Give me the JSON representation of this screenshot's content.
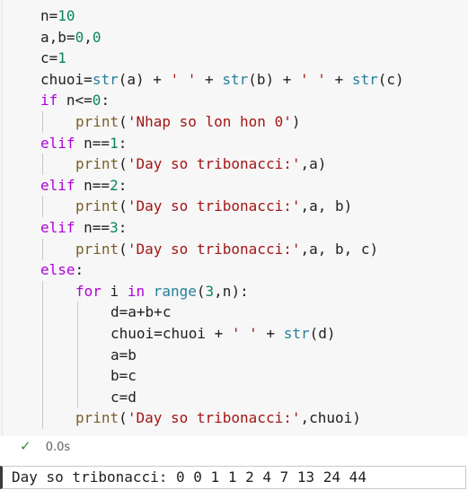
{
  "code": {
    "lines": [
      {
        "indent": 0,
        "tokens": [
          {
            "t": "n",
            "c": "plain"
          },
          {
            "t": "=",
            "c": "op"
          },
          {
            "t": "10",
            "c": "nm"
          }
        ]
      },
      {
        "indent": 0,
        "tokens": [
          {
            "t": "a",
            "c": "plain"
          },
          {
            "t": ",",
            "c": "op"
          },
          {
            "t": "b",
            "c": "plain"
          },
          {
            "t": "=",
            "c": "op"
          },
          {
            "t": "0",
            "c": "nm"
          },
          {
            "t": ",",
            "c": "op"
          },
          {
            "t": "0",
            "c": "nm"
          }
        ]
      },
      {
        "indent": 0,
        "tokens": [
          {
            "t": "c",
            "c": "plain"
          },
          {
            "t": "=",
            "c": "op"
          },
          {
            "t": "1",
            "c": "nm"
          }
        ]
      },
      {
        "indent": 0,
        "tokens": [
          {
            "t": "chuoi",
            "c": "plain"
          },
          {
            "t": "=",
            "c": "op"
          },
          {
            "t": "str",
            "c": "fn"
          },
          {
            "t": "(a) + ",
            "c": "plain"
          },
          {
            "t": "' '",
            "c": "st"
          },
          {
            "t": " + ",
            "c": "plain"
          },
          {
            "t": "str",
            "c": "fn"
          },
          {
            "t": "(b) + ",
            "c": "plain"
          },
          {
            "t": "' '",
            "c": "st"
          },
          {
            "t": " + ",
            "c": "plain"
          },
          {
            "t": "str",
            "c": "fn"
          },
          {
            "t": "(c)",
            "c": "plain"
          }
        ]
      },
      {
        "indent": 0,
        "tokens": [
          {
            "t": "if",
            "c": "kw"
          },
          {
            "t": " n<=",
            "c": "plain"
          },
          {
            "t": "0",
            "c": "nm"
          },
          {
            "t": ":",
            "c": "plain"
          }
        ]
      },
      {
        "indent": 1,
        "tokens": [
          {
            "t": "print",
            "c": "bi"
          },
          {
            "t": "(",
            "c": "plain"
          },
          {
            "t": "'Nhap so lon hon 0'",
            "c": "st"
          },
          {
            "t": ")",
            "c": "plain"
          }
        ]
      },
      {
        "indent": 0,
        "tokens": [
          {
            "t": "elif",
            "c": "kw"
          },
          {
            "t": " n==",
            "c": "plain"
          },
          {
            "t": "1",
            "c": "nm"
          },
          {
            "t": ":",
            "c": "plain"
          }
        ]
      },
      {
        "indent": 1,
        "tokens": [
          {
            "t": "print",
            "c": "bi"
          },
          {
            "t": "(",
            "c": "plain"
          },
          {
            "t": "'Day so tribonacci:'",
            "c": "st"
          },
          {
            "t": ",a)",
            "c": "plain"
          }
        ]
      },
      {
        "indent": 0,
        "tokens": [
          {
            "t": "elif",
            "c": "kw"
          },
          {
            "t": " n==",
            "c": "plain"
          },
          {
            "t": "2",
            "c": "nm"
          },
          {
            "t": ":",
            "c": "plain"
          }
        ]
      },
      {
        "indent": 1,
        "tokens": [
          {
            "t": "print",
            "c": "bi"
          },
          {
            "t": "(",
            "c": "plain"
          },
          {
            "t": "'Day so tribonacci:'",
            "c": "st"
          },
          {
            "t": ",a, b)",
            "c": "plain"
          }
        ]
      },
      {
        "indent": 0,
        "tokens": [
          {
            "t": "elif",
            "c": "kw"
          },
          {
            "t": " n==",
            "c": "plain"
          },
          {
            "t": "3",
            "c": "nm"
          },
          {
            "t": ":",
            "c": "plain"
          }
        ]
      },
      {
        "indent": 1,
        "tokens": [
          {
            "t": "print",
            "c": "bi"
          },
          {
            "t": "(",
            "c": "plain"
          },
          {
            "t": "'Day so tribonacci:'",
            "c": "st"
          },
          {
            "t": ",a, b, c)",
            "c": "plain"
          }
        ]
      },
      {
        "indent": 0,
        "tokens": [
          {
            "t": "else",
            "c": "kw"
          },
          {
            "t": ":",
            "c": "plain"
          }
        ]
      },
      {
        "indent": 1,
        "tokens": [
          {
            "t": "for",
            "c": "kw"
          },
          {
            "t": " i ",
            "c": "plain"
          },
          {
            "t": "in",
            "c": "kw"
          },
          {
            "t": " ",
            "c": "plain"
          },
          {
            "t": "range",
            "c": "fn"
          },
          {
            "t": "(",
            "c": "plain"
          },
          {
            "t": "3",
            "c": "nm"
          },
          {
            "t": ",n):",
            "c": "plain"
          }
        ]
      },
      {
        "indent": 2,
        "tokens": [
          {
            "t": "d",
            "c": "plain"
          },
          {
            "t": "=",
            "c": "op"
          },
          {
            "t": "a+b+c",
            "c": "plain"
          }
        ]
      },
      {
        "indent": 2,
        "tokens": [
          {
            "t": "chuoi",
            "c": "plain"
          },
          {
            "t": "=",
            "c": "op"
          },
          {
            "t": "chuoi + ",
            "c": "plain"
          },
          {
            "t": "' '",
            "c": "st"
          },
          {
            "t": " + ",
            "c": "plain"
          },
          {
            "t": "str",
            "c": "fn"
          },
          {
            "t": "(d)",
            "c": "plain"
          }
        ]
      },
      {
        "indent": 2,
        "tokens": [
          {
            "t": "a",
            "c": "plain"
          },
          {
            "t": "=",
            "c": "op"
          },
          {
            "t": "b",
            "c": "plain"
          }
        ]
      },
      {
        "indent": 2,
        "tokens": [
          {
            "t": "b",
            "c": "plain"
          },
          {
            "t": "=",
            "c": "op"
          },
          {
            "t": "c",
            "c": "plain"
          }
        ]
      },
      {
        "indent": 2,
        "tokens": [
          {
            "t": "c",
            "c": "plain"
          },
          {
            "t": "=",
            "c": "op"
          },
          {
            "t": "d",
            "c": "plain"
          }
        ]
      },
      {
        "indent": 1,
        "tokens": [
          {
            "t": "print",
            "c": "bi"
          },
          {
            "t": "(",
            "c": "plain"
          },
          {
            "t": "'Day so tribonacci:'",
            "c": "st"
          },
          {
            "t": ",chuoi)",
            "c": "plain"
          }
        ]
      }
    ]
  },
  "status": {
    "icon": "check-icon",
    "duration": "0.0s",
    "success_color": "#388a34"
  },
  "output": {
    "text": "Day so tribonacci: 0 0 1 1 2 4 7 13 24 44"
  }
}
